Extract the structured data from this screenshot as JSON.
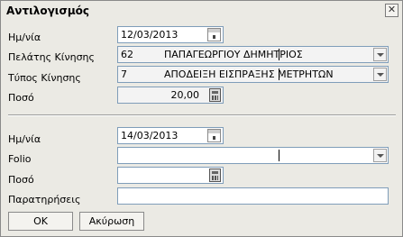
{
  "window": {
    "title": "Αντιλογισμός",
    "close_glyph": "✕"
  },
  "top": {
    "date_label": "Ημ/νία",
    "date_value": "12/03/2013",
    "customer_label": "Πελάτης Κίνησης",
    "customer_code": "62",
    "customer_name": "ΠΑΠΑΓΕΩΡΓΙΟΥ ΔΗΜΗΤΡΙΟΣ",
    "type_label": "Τύπος Κίνησης",
    "type_code": "7",
    "type_name": "ΑΠΟΔΕΙΞΗ ΕΙΣΠΡΑΞΗΣ ΜΕΤΡΗΤΩΝ",
    "amount_label": "Ποσό",
    "amount_value": "20,00"
  },
  "bottom": {
    "date_label": "Ημ/νία",
    "date_value": "14/03/2013",
    "folio_label": "Folio",
    "folio_value": "",
    "amount_label": "Ποσό",
    "amount_value": "",
    "notes_label": "Παρατηρήσεις",
    "notes_value": ""
  },
  "buttons": {
    "ok": "OK",
    "cancel": "Ακύρωση"
  },
  "icons": {
    "calendar": "calendar-icon",
    "calculator": "calculator-icon",
    "dropdown": "chevron-down-icon"
  }
}
